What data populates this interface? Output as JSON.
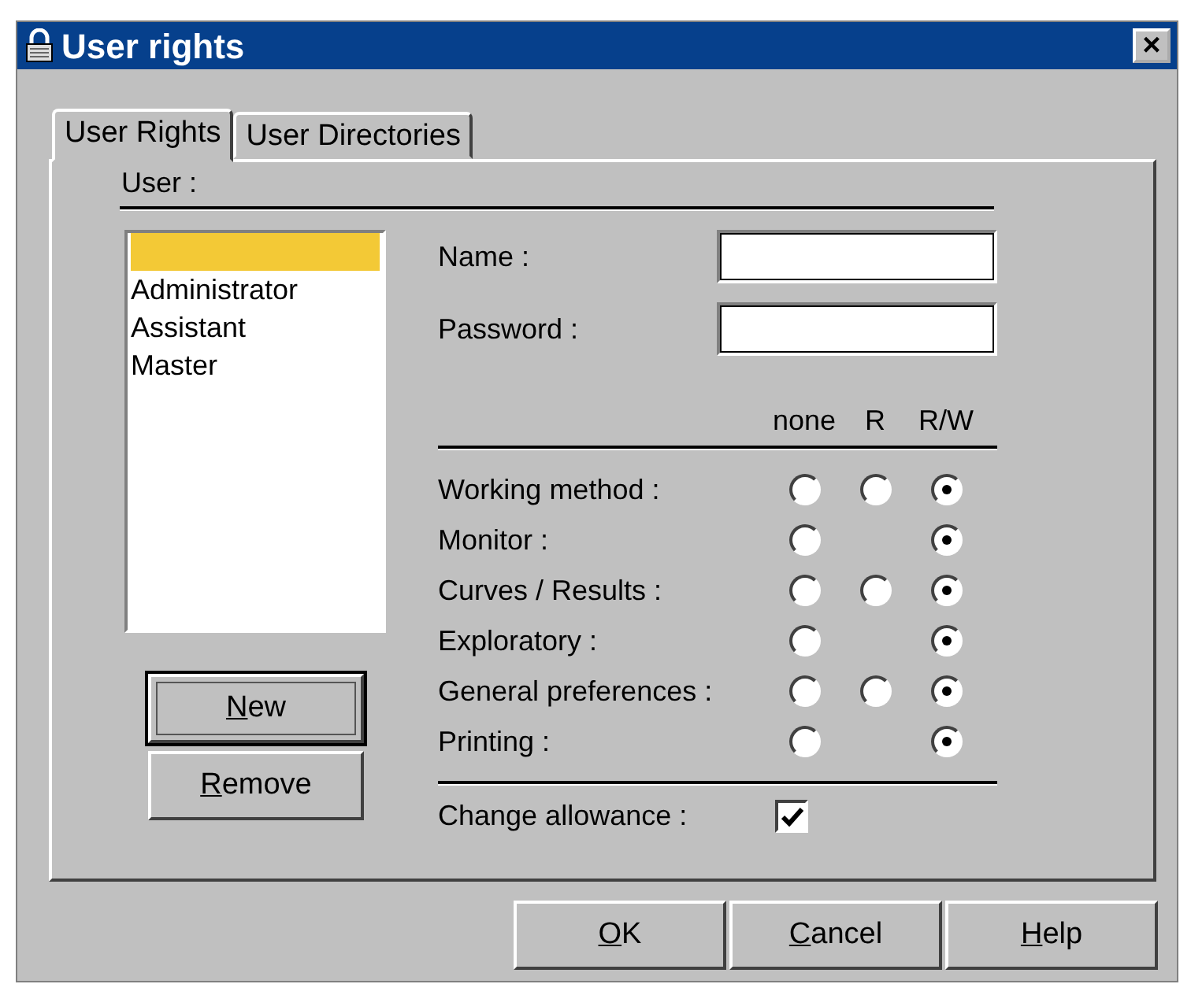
{
  "window": {
    "title": "User rights",
    "close": "×"
  },
  "tabs": [
    {
      "label": "User Rights",
      "selected": true
    },
    {
      "label": "User Directories",
      "selected": false
    }
  ],
  "user_group": {
    "label": "User :",
    "users": [
      {
        "selected": true
      },
      {
        "label": "Administrator",
        "selected": false
      },
      {
        "label": "Assistant",
        "selected": false
      },
      {
        "label": "Master",
        "selected": false
      }
    ],
    "buttons": [
      {
        "label": "New",
        "underline_first": true,
        "default": true
      },
      {
        "label": "Remove",
        "underline_first": true,
        "default": false
      }
    ]
  },
  "fields": [
    {
      "label": "Name :"
    },
    {
      "label": "Password :"
    }
  ],
  "rights": {
    "columns": [
      "none",
      "R",
      "R/W"
    ],
    "rows": [
      {
        "label": "Working method :",
        "options": [
          {
            "selected": false
          },
          {
            "selected": false
          },
          {
            "selected": true
          }
        ]
      },
      {
        "label": "Monitor :",
        "options": [
          {
            "selected": false
          },
          {
            "kind": "empty"
          },
          {
            "selected": true
          }
        ]
      },
      {
        "label": "Curves / Results :",
        "options": [
          {
            "selected": false
          },
          {
            "selected": false
          },
          {
            "selected": true
          }
        ]
      },
      {
        "label": "Exploratory :",
        "options": [
          {
            "selected": false
          },
          {
            "kind": "empty"
          },
          {
            "selected": true
          }
        ]
      },
      {
        "label": "General preferences :",
        "options": [
          {
            "selected": false
          },
          {
            "selected": false
          },
          {
            "selected": true
          }
        ]
      },
      {
        "label": "Printing :",
        "options": [
          {
            "selected": false
          },
          {
            "kind": "empty"
          },
          {
            "selected": true
          }
        ]
      }
    ]
  },
  "change_allowance": {
    "label": "Change allowance :",
    "checked": true
  },
  "dialog_buttons": [
    {
      "label": "OK",
      "underline_first": true
    },
    {
      "label": "Cancel",
      "underline_first": true
    },
    {
      "label": "Help",
      "underline_first": true
    }
  ]
}
